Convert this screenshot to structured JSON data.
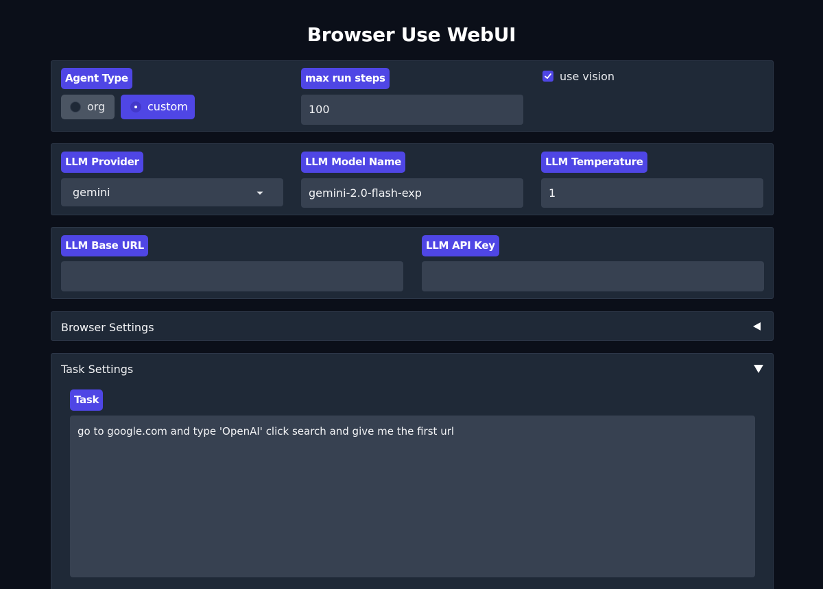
{
  "app": {
    "title": "Browser Use WebUI"
  },
  "agent": {
    "type_label": "Agent Type",
    "options": [
      "org",
      "custom"
    ],
    "selected": "custom",
    "max_steps_label": "max run steps",
    "max_steps_value": "100",
    "use_vision_label": "use vision",
    "use_vision_checked": true
  },
  "llm": {
    "provider_label": "LLM Provider",
    "provider_value": "gemini",
    "model_label": "LLM Model Name",
    "model_value": "gemini-2.0-flash-exp",
    "temperature_label": "LLM Temperature",
    "temperature_value": "1",
    "base_url_label": "LLM Base URL",
    "base_url_value": "",
    "api_key_label": "LLM API Key",
    "api_key_value": ""
  },
  "browser_settings": {
    "label": "Browser Settings",
    "icon": "triangle-left-icon"
  },
  "task_settings": {
    "label": "Task Settings",
    "icon": "triangle-down-icon",
    "task_label": "Task",
    "task_value": "go to google.com and type 'OpenAI' click search and give me the first url"
  },
  "colors": {
    "background": "#0b0f19",
    "panel": "#1f2937",
    "input": "#374151",
    "accent": "#4f46e5"
  }
}
